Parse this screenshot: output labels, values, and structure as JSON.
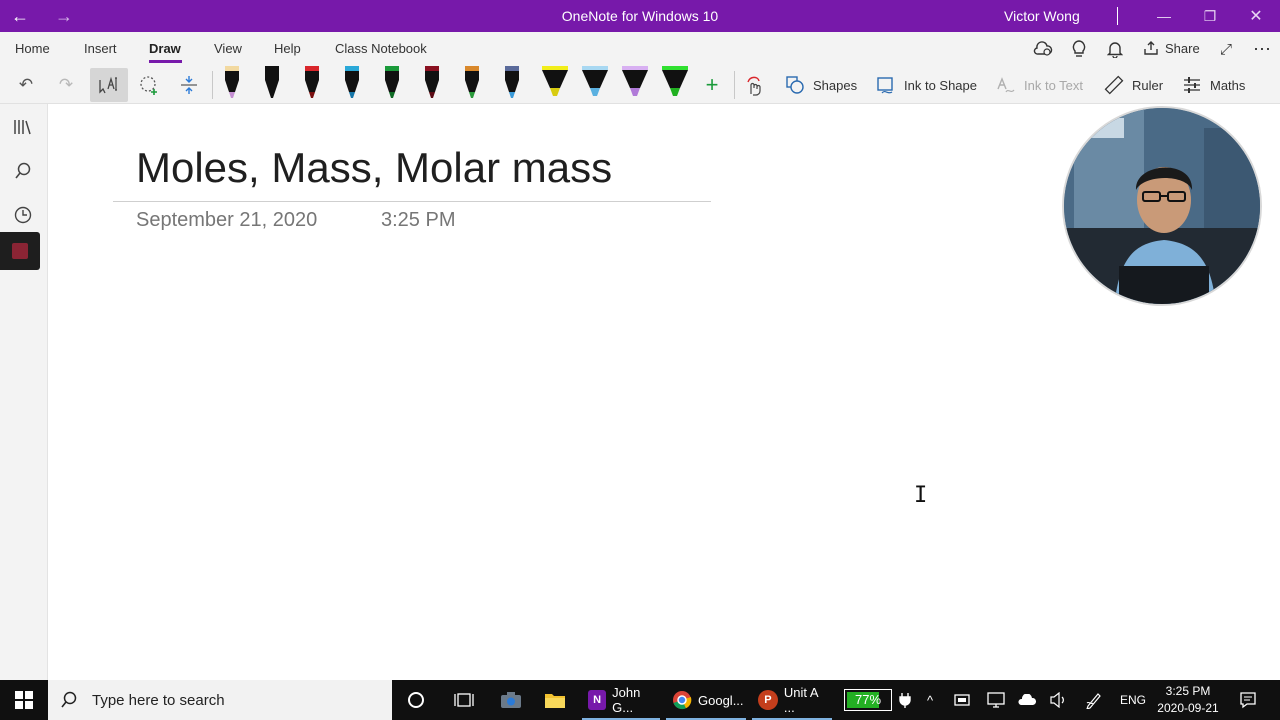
{
  "titlebar": {
    "app_title": "OneNote for Windows 10",
    "user_name": "Victor Wong",
    "accent_color": "#7719aa"
  },
  "ribbon": {
    "tabs": [
      "Home",
      "Insert",
      "Draw",
      "View",
      "Help",
      "Class Notebook"
    ],
    "active_tab": "Draw",
    "share_label": "Share"
  },
  "toolbar": {
    "pens": [
      {
        "color": "#f2d9a0",
        "tip": "#c48fd2"
      },
      {
        "color": "#111111",
        "tip": "#111111"
      },
      {
        "color": "#d9262b",
        "tip": "#7a1010"
      },
      {
        "color": "#2aa8d8",
        "tip": "#1676a8"
      },
      {
        "color": "#1a9a3a",
        "tip": "#0f6b25"
      },
      {
        "color": "#8a1020",
        "tip": "#5b0a14"
      },
      {
        "color": "#d9882b",
        "tip": "#2a9a3a"
      },
      {
        "color": "#5a6a9a",
        "tip": "#3a9ad8"
      },
      {
        "color": "#f2ee1a",
        "tip": "#d8cc10"
      },
      {
        "color": "#a8d8f2",
        "tip": "#5ab0e0"
      },
      {
        "color": "#d8b0f2",
        "tip": "#b07ad8"
      },
      {
        "color": "#30e030",
        "tip": "#20b020"
      }
    ],
    "shapes_label": "Shapes",
    "ink_to_shape_label": "Ink to Shape",
    "ink_to_text_label": "Ink to Text",
    "ruler_label": "Ruler",
    "maths_label": "Maths"
  },
  "page": {
    "title": "Moles, Mass, Molar mass",
    "date": "September 21, 2020",
    "time": "3:25 PM"
  },
  "taskbar": {
    "search_placeholder": "Type here to search",
    "apps": [
      {
        "label": "John G...",
        "badge": "N",
        "badge_color": "#7719aa"
      },
      {
        "label": "Googl...",
        "badge": "",
        "badge_color": "#ffffff"
      },
      {
        "label": "Unit A ...",
        "badge": "P",
        "badge_color": "#c43e1c"
      }
    ],
    "battery": "77%",
    "battery_level": 0.77,
    "language": "ENG",
    "time": "3:25 PM",
    "date": "2020-09-21"
  }
}
